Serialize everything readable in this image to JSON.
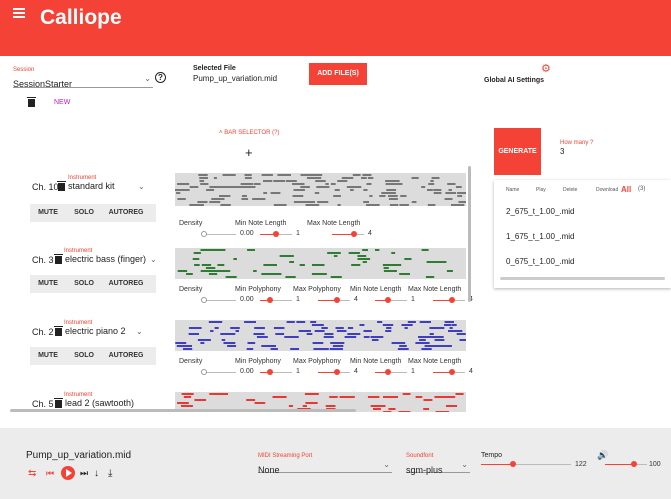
{
  "app": {
    "title": "Calliope"
  },
  "session": {
    "label": "Session",
    "value": "SessionStarter",
    "new_label": "NEW"
  },
  "file": {
    "label": "Selected File",
    "value": "Pump_up_variation.mid",
    "add_label": "ADD FILE(S)"
  },
  "global": {
    "label": "Global AI Settings"
  },
  "bar_selector": {
    "label": "BAR SELECTOR (?)"
  },
  "generate": {
    "label": "GENERATE",
    "how_many_label": "How many ?",
    "how_many_value": "3"
  },
  "results": {
    "headers": {
      "name": "Name",
      "play": "Play",
      "delete": "Delete",
      "download": "Download",
      "all": "All",
      "count": "(3)"
    },
    "files": [
      "2_675_t_1.00_.mid",
      "1_675_t_1.00_.mid",
      "0_675_t_1.00_.mid"
    ]
  },
  "tracks": [
    {
      "instrument_label": "Instrument",
      "channel": "Ch. 10",
      "instrument": "standard kit",
      "buttons": [
        "MUTE",
        "SOLO",
        "AUTOREG"
      ],
      "controls": [
        {
          "label": "Density",
          "value": "0.00",
          "level": 0
        },
        {
          "label": "Min Note Length",
          "value": "1",
          "level": 0.5
        },
        {
          "label": "Max Note Length",
          "value": "4",
          "level": 0.7
        }
      ]
    },
    {
      "instrument_label": "Instrument",
      "channel": "Ch. 3",
      "instrument": "electric bass (finger)",
      "buttons": [
        "MUTE",
        "SOLO",
        "AUTOREG"
      ],
      "controls": [
        {
          "label": "Density",
          "value": "0.00",
          "level": 0
        },
        {
          "label": "Min Polyphony",
          "value": "1",
          "level": 0.3
        },
        {
          "label": "Max Polyphony",
          "value": "4",
          "level": 0.6
        },
        {
          "label": "Min Note Length",
          "value": "1",
          "level": 0.4
        },
        {
          "label": "Max Note Length",
          "value": "4",
          "level": 0.6
        }
      ]
    },
    {
      "instrument_label": "Instrument",
      "channel": "Ch. 2",
      "instrument": "electric piano 2",
      "buttons": [
        "MUTE",
        "SOLO",
        "AUTOREG"
      ],
      "controls": [
        {
          "label": "Density",
          "value": "0.00",
          "level": 0
        },
        {
          "label": "Min Polyphony",
          "value": "1",
          "level": 0.3
        },
        {
          "label": "Max Polyphony",
          "value": "4",
          "level": 0.6
        },
        {
          "label": "Min Note Length",
          "value": "1",
          "level": 0.4
        },
        {
          "label": "Max Note Length",
          "value": "4",
          "level": 0.6
        }
      ]
    },
    {
      "instrument_label": "Instrument",
      "channel": "Ch. 5",
      "instrument": "lead 2 (sawtooth)"
    }
  ],
  "player": {
    "file": "Pump_up_variation.mid",
    "midi_label": "MIDI Streaming Port",
    "midi_value": "None",
    "soundfont_label": "Soundfont",
    "soundfont_value": "sgm-plus",
    "tempo_label": "Tempo",
    "tempo_value": "122",
    "tempo_level": 0.35,
    "volume_value": "100",
    "volume_level": 0.7
  },
  "colors": {
    "accent": "#f44336",
    "drums": "#777777",
    "bass": "#2e7d32",
    "piano": "#3f3fbf",
    "lead": "#e53935"
  }
}
